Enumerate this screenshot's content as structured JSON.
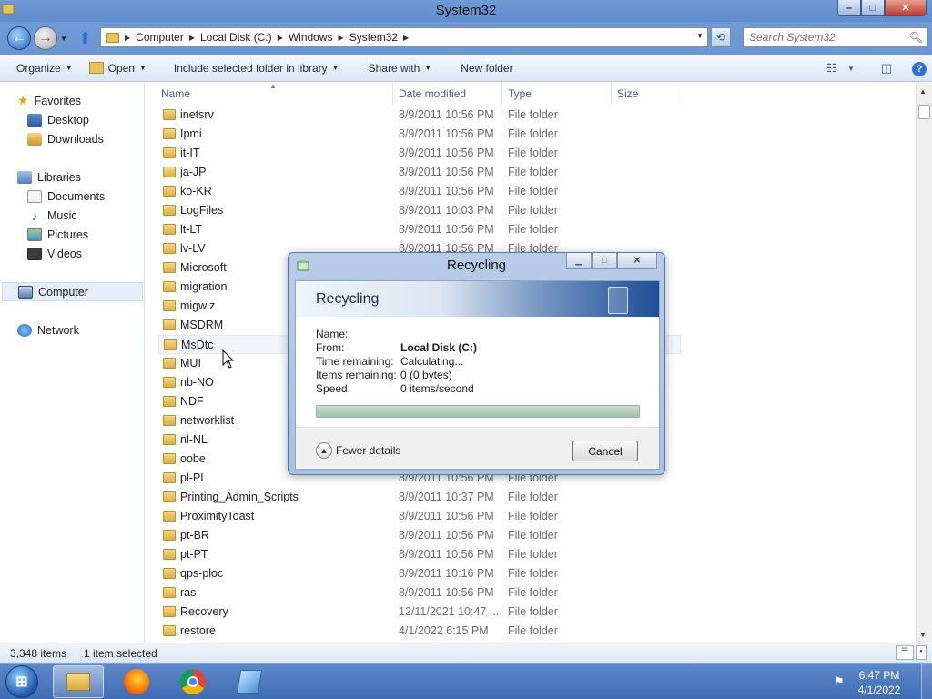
{
  "window": {
    "title": "System32"
  },
  "address": {
    "crumbs": [
      "Computer",
      "Local Disk (C:)",
      "Windows",
      "System32"
    ],
    "search_placeholder": "Search System32"
  },
  "toolbar": {
    "organize": "Organize",
    "open": "Open",
    "include": "Include selected folder in library",
    "share": "Share with",
    "new_folder": "New folder"
  },
  "nav": {
    "favorites": "Favorites",
    "desktop": "Desktop",
    "downloads": "Downloads",
    "libraries": "Libraries",
    "documents": "Documents",
    "music": "Music",
    "pictures": "Pictures",
    "videos": "Videos",
    "computer": "Computer",
    "network": "Network"
  },
  "columns": {
    "name": "Name",
    "date": "Date modified",
    "type": "Type",
    "size": "Size"
  },
  "files": [
    {
      "name": "inetsrv",
      "date": "8/9/2011 10:56 PM",
      "type": "File folder"
    },
    {
      "name": "Ipmi",
      "date": "8/9/2011 10:56 PM",
      "type": "File folder"
    },
    {
      "name": "it-IT",
      "date": "8/9/2011 10:56 PM",
      "type": "File folder"
    },
    {
      "name": "ja-JP",
      "date": "8/9/2011 10:56 PM",
      "type": "File folder"
    },
    {
      "name": "ko-KR",
      "date": "8/9/2011 10:56 PM",
      "type": "File folder"
    },
    {
      "name": "LogFiles",
      "date": "8/9/2011 10:03 PM",
      "type": "File folder"
    },
    {
      "name": "lt-LT",
      "date": "8/9/2011 10:56 PM",
      "type": "File folder"
    },
    {
      "name": "lv-LV",
      "date": "8/9/2011 10:56 PM",
      "type": "File folder"
    },
    {
      "name": "Microsoft",
      "date": "",
      "type": ""
    },
    {
      "name": "migration",
      "date": "",
      "type": ""
    },
    {
      "name": "migwiz",
      "date": "",
      "type": ""
    },
    {
      "name": "MSDRM",
      "date": "",
      "type": ""
    },
    {
      "name": "MsDtc",
      "date": "",
      "type": ""
    },
    {
      "name": "MUI",
      "date": "",
      "type": ""
    },
    {
      "name": "nb-NO",
      "date": "",
      "type": ""
    },
    {
      "name": "NDF",
      "date": "",
      "type": ""
    },
    {
      "name": "networklist",
      "date": "",
      "type": ""
    },
    {
      "name": "nl-NL",
      "date": "",
      "type": ""
    },
    {
      "name": "oobe",
      "date": "",
      "type": ""
    },
    {
      "name": "pl-PL",
      "date": "8/9/2011 10:56 PM",
      "type": "File folder"
    },
    {
      "name": "Printing_Admin_Scripts",
      "date": "8/9/2011 10:37 PM",
      "type": "File folder"
    },
    {
      "name": "ProximityToast",
      "date": "8/9/2011 10:56 PM",
      "type": "File folder"
    },
    {
      "name": "pt-BR",
      "date": "8/9/2011 10:56 PM",
      "type": "File folder"
    },
    {
      "name": "pt-PT",
      "date": "8/9/2011 10:56 PM",
      "type": "File folder"
    },
    {
      "name": "qps-ploc",
      "date": "8/9/2011 10:16 PM",
      "type": "File folder"
    },
    {
      "name": "ras",
      "date": "8/9/2011 10:56 PM",
      "type": "File folder"
    },
    {
      "name": "Recovery",
      "date": "12/11/2021 10:47 ...",
      "type": "File folder"
    },
    {
      "name": "restore",
      "date": "4/1/2022 6:15 PM",
      "type": "File folder"
    }
  ],
  "status": {
    "items": "3,348 items",
    "selected": "1 item selected"
  },
  "dialog": {
    "title": "Recycling",
    "header": "Recycling",
    "name_label": "Name:",
    "name_value": "",
    "from_label": "From:",
    "from_value": "Local Disk (C:)",
    "time_label": "Time remaining:",
    "time_value": "Calculating...",
    "items_label": "Items remaining:",
    "items_value": "0 (0 bytes)",
    "speed_label": "Speed:",
    "speed_value": "0 items/second",
    "progress": 1.0,
    "fewer_details": "Fewer details",
    "cancel": "Cancel"
  },
  "taskbar": {
    "time": "6:47 PM",
    "date": "4/1/2022"
  },
  "colors": {
    "title_bar": "#6f9bd6",
    "taskbar": "#3f6cb3",
    "progress_fill": "#9fc0a6"
  }
}
